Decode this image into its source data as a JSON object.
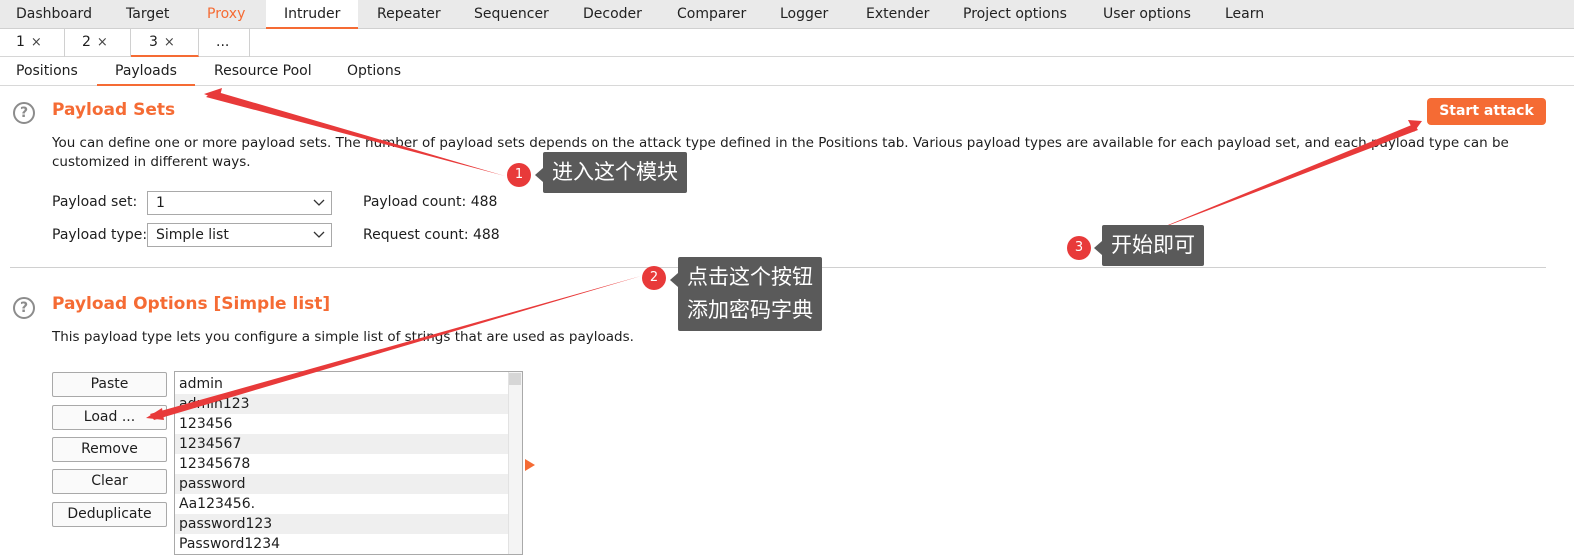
{
  "top_tabs": [
    "Dashboard",
    "Target",
    "Proxy",
    "Intruder",
    "Repeater",
    "Sequencer",
    "Decoder",
    "Comparer",
    "Logger",
    "Extender",
    "Project options",
    "User options",
    "Learn"
  ],
  "instance_tabs": [
    {
      "label": "1",
      "close": "×"
    },
    {
      "label": "2",
      "close": "×"
    },
    {
      "label": "3",
      "close": "×"
    },
    {
      "label": "...",
      "close": ""
    }
  ],
  "sub_tabs": [
    "Positions",
    "Payloads",
    "Resource Pool",
    "Options"
  ],
  "payload_sets": {
    "help": "?",
    "title": "Payload Sets",
    "start_attack": "Start attack",
    "description": "You can define one or more payload sets. The number of payload sets depends on the attack type defined in the Positions tab. Various payload types are available for each payload set, and each payload type can be customized in different ways.",
    "set_label": "Payload set:",
    "set_value": "1",
    "type_label": "Payload type:",
    "type_value": "Simple list",
    "payload_count": "Payload count:  488",
    "request_count": "Request count:  488"
  },
  "payload_options": {
    "help": "?",
    "title": "Payload Options [Simple list]",
    "description": "This payload type lets you configure a simple list of strings that are used as payloads.",
    "buttons": [
      "Paste",
      "Load ...",
      "Remove",
      "Clear",
      "Deduplicate"
    ],
    "list": [
      "admin",
      "admin123",
      "123456",
      "1234567",
      "12345678",
      "password",
      "Aa123456.",
      "password123",
      "Password1234"
    ]
  },
  "annotations": [
    {
      "num": "1",
      "text": "进入这个模块"
    },
    {
      "num": "2",
      "text": "点击这个按钮\n添加密码字典"
    },
    {
      "num": "3",
      "text": "开始即可"
    }
  ],
  "colors": {
    "accent": "#f56b34",
    "annotation_red": "#e83a3a",
    "tooltip_bg": "#5a5a5a"
  }
}
